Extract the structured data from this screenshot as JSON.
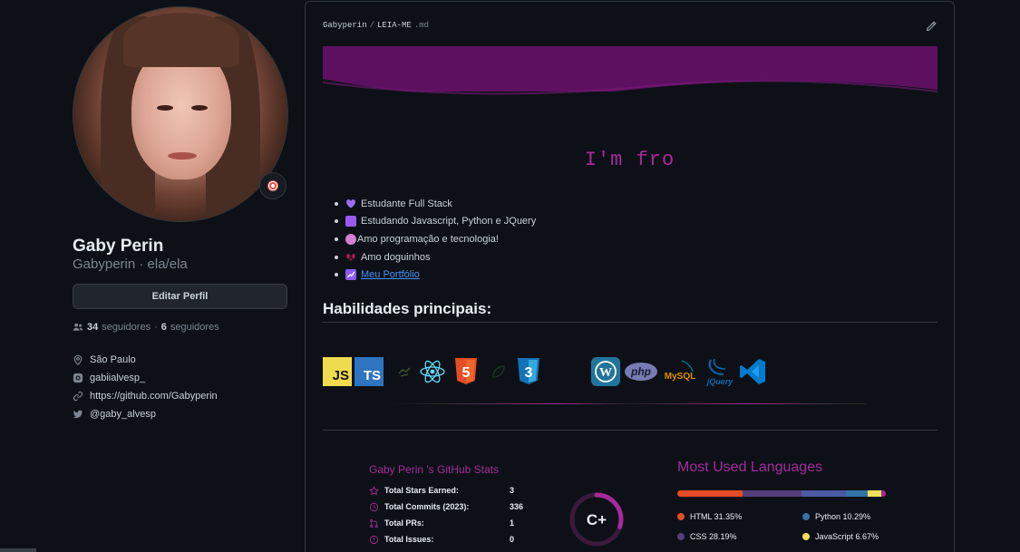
{
  "profile": {
    "name": "Gaby Perin",
    "login_line": "Gabyperin · ela/ela",
    "edit_label": "Editar Perfil",
    "followers_count": "34",
    "followers_label": "seguidores",
    "following_count": "6",
    "following_label": "seguidores",
    "location": "São Paulo",
    "instagram": "gabiialvesp_",
    "website": "https://github.com/Gabyperin",
    "twitter": "@gaby_alvesp"
  },
  "readme": {
    "owner": "Gabyperin",
    "file": "LEIA-ME",
    "ext": ".md",
    "typing_text": "I'm fro",
    "bullets": [
      {
        "text": "Estudante Full Stack",
        "icon": "purple-heart-icon",
        "color": "#9b6cf0"
      },
      {
        "text": "Estudando Javascript, Python e JQuery",
        "icon": "purple-square-icon",
        "color": "#9b59f0"
      },
      {
        "text": "Amo programação e tecnologia!",
        "icon": "brain-icon",
        "color": "#d27fd4"
      },
      {
        "text": "Amo doguinhos",
        "icon": "dog-icon",
        "color": "#c2185b"
      },
      {
        "text": "Meu Portfólio",
        "icon": "chart-icon",
        "color": "#9b6cf0"
      }
    ],
    "skills_heading": "Habilidades principais:",
    "skills": [
      {
        "name": "JS",
        "icon": "javascript-icon"
      },
      {
        "name": "TS",
        "icon": "typescript-icon"
      },
      {
        "name": "",
        "icon": "nodejs-icon"
      },
      {
        "name": "",
        "icon": "react-icon"
      },
      {
        "name": "5",
        "icon": "html5-icon"
      },
      {
        "name": "",
        "icon": "nodejs-leaf-icon"
      },
      {
        "name": "3",
        "icon": "css3-icon"
      },
      {
        "name": "",
        "icon": "wordpress-icon"
      },
      {
        "name": "php",
        "icon": "php-icon"
      },
      {
        "name": "MySQL",
        "icon": "mysql-icon"
      },
      {
        "name": "jQuery",
        "icon": "jquery-icon"
      },
      {
        "name": "",
        "icon": "vscode-icon"
      }
    ]
  },
  "stats": {
    "title": "Gaby Perin 's GitHub Stats",
    "rows": [
      {
        "label": "Total Stars Earned:",
        "value": "3",
        "icon": "star-icon"
      },
      {
        "label": "Total Commits (2023):",
        "value": "336",
        "icon": "history-icon"
      },
      {
        "label": "Total PRs:",
        "value": "1",
        "icon": "pull-request-icon"
      },
      {
        "label": "Total Issues:",
        "value": "0",
        "icon": "issue-icon"
      }
    ],
    "grade": "C+",
    "grade_progress": 0.3
  },
  "languages": {
    "title": "Most Used Languages",
    "items": [
      {
        "name": "HTML",
        "percent": 31.35,
        "label": "HTML 31.35%",
        "color": "#e34c26"
      },
      {
        "name": "CSS",
        "percent": 28.19,
        "label": "CSS 28.19%",
        "color": "#563d7c"
      },
      {
        "name": "Python",
        "percent": 10.29,
        "label": "Python 10.29%",
        "color": "#3572a5"
      },
      {
        "name": "JavaScript",
        "percent": 6.67,
        "label": "JavaScript 6.67%",
        "color": "#f1e05a"
      }
    ],
    "bar_segments": [
      {
        "percent": 31.35,
        "color": "#e34c26"
      },
      {
        "percent": 28.19,
        "color": "#563d7c"
      },
      {
        "percent": 21.5,
        "color": "#4c5aa0"
      },
      {
        "percent": 10.29,
        "color": "#3572a5"
      },
      {
        "percent": 6.67,
        "color": "#f1e05a"
      },
      {
        "percent": 2.0,
        "color": "#a52a9c"
      }
    ]
  },
  "colors": {
    "accent": "#a52a9c",
    "link": "#4493f8",
    "background": "#0d1117"
  }
}
